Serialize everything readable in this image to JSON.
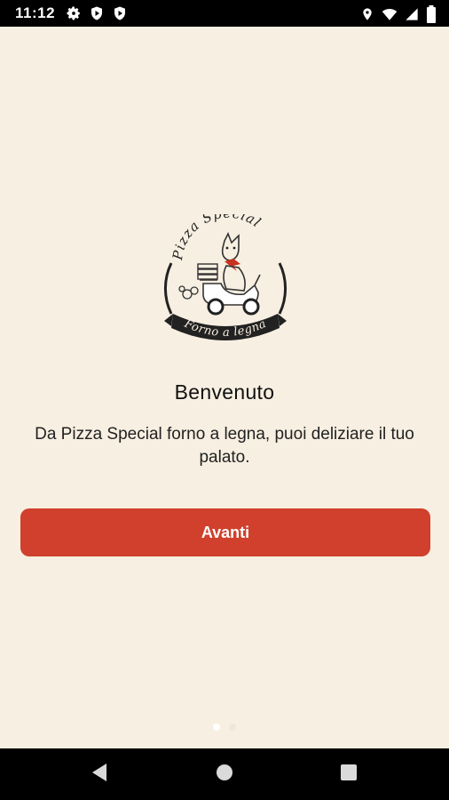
{
  "status_bar": {
    "time": "11:12",
    "left_icons": [
      "gear-icon",
      "shield-play-icon",
      "shield-play-icon"
    ],
    "right_icons": [
      "location-icon",
      "wifi-icon",
      "signal-icon",
      "battery-icon"
    ]
  },
  "logo": {
    "top_text": "Pizza Special",
    "banner_text": "Forno a legna"
  },
  "welcome": {
    "title": "Benvenuto",
    "text": "Da Pizza Special forno a legna, puoi deliziare il tuo palato."
  },
  "actions": {
    "next_label": "Avanti"
  },
  "pagination": {
    "current": 1,
    "total": 2
  },
  "colors": {
    "background": "#F7EFE1",
    "accent": "#D0402C"
  },
  "nav_bar": {
    "buttons": [
      "back-icon",
      "home-icon",
      "recents-icon"
    ]
  }
}
